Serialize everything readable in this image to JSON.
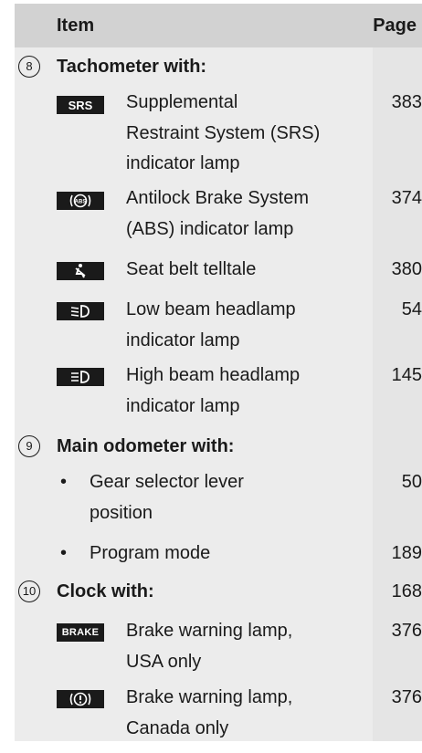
{
  "header": {
    "item_label": "Item",
    "page_label": "Page"
  },
  "rows": {
    "tachometer": {
      "number": "8",
      "label": "Tachometer with:"
    },
    "srs": {
      "icon_text": "SRS",
      "icon": "srs-icon",
      "line1": "Supplemental",
      "line2": "Restraint System (SRS)",
      "line3": "indicator lamp",
      "page": "383"
    },
    "abs": {
      "icon": "abs-icon",
      "line1": "Antilock Brake System",
      "line2": "(ABS) indicator lamp",
      "page": "374"
    },
    "seatbelt": {
      "icon": "seat-belt-icon",
      "line1": "Seat belt telltale",
      "page": "380"
    },
    "lowbeam": {
      "icon": "low-beam-icon",
      "line1": "Low beam headlamp",
      "line2": "indicator lamp",
      "page": "54"
    },
    "highbeam": {
      "icon": "high-beam-icon",
      "line1": "High beam headlamp",
      "line2": "indicator lamp",
      "page": "145"
    },
    "odometer": {
      "number": "9",
      "label": "Main odometer with:"
    },
    "gear": {
      "bullet": "•",
      "line1": "Gear selector lever",
      "line2": "position",
      "page": "50"
    },
    "program": {
      "bullet": "•",
      "line1": "Program mode",
      "page": "189"
    },
    "clock": {
      "number": "10",
      "label": "Clock with:",
      "page": "168"
    },
    "brake_usa": {
      "icon_text": "BRAKE",
      "icon": "brake-text-icon",
      "line1": "Brake warning lamp,",
      "line2": "USA only",
      "page": "376"
    },
    "brake_canada": {
      "icon": "brake-warning-icon",
      "line1": "Brake warning lamp,",
      "line2": "Canada only",
      "page": "376"
    }
  }
}
